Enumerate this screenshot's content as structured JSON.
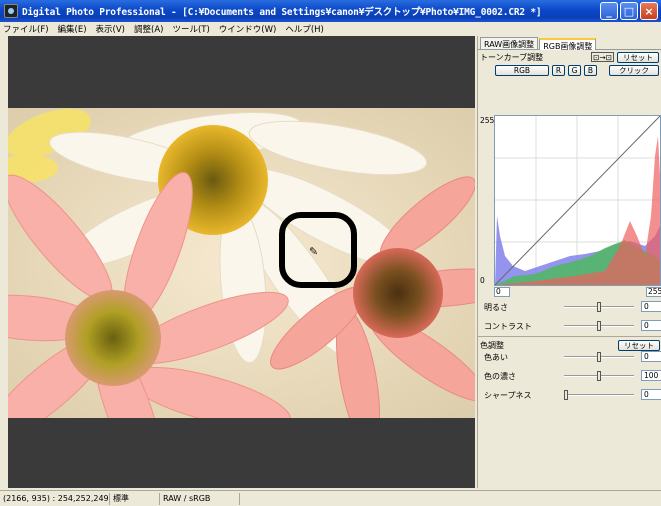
{
  "window": {
    "title": "Digital Photo Professional - [C:¥Documents and Settings¥canon¥デスクトップ¥Photo¥IMG_0002.CR2 *]",
    "minimize": "_",
    "maximize": "□",
    "close": "×"
  },
  "menu": [
    "ファイル(F)",
    "編集(E)",
    "表示(V)",
    "調整(A)",
    "ツール(T)",
    "ウインドウ(W)",
    "ヘルプ(H)"
  ],
  "panel": {
    "tabs": [
      {
        "label": "RAW画像調整",
        "active": false
      },
      {
        "label": "RGB画像調整",
        "active": true
      }
    ],
    "tone_curve": {
      "label": "トーンカーブ調整",
      "copy_icon": "⊡→⊡",
      "reset": "リセット",
      "rgb": "RGB",
      "r": "R",
      "g": "G",
      "b": "B",
      "click": "クリック",
      "max_left": "255",
      "min_left": "0",
      "input_min": "0",
      "input_max": "255"
    },
    "brightness": {
      "label": "明るさ",
      "value": "0",
      "level": 0.5
    },
    "contrast": {
      "label": "コントラスト",
      "value": "0",
      "level": 0.5
    },
    "color": {
      "section": "色調整",
      "reset": "リセット",
      "hue": {
        "label": "色あい",
        "value": "0",
        "level": 0.5
      },
      "saturation": {
        "label": "色の濃さ",
        "value": "100",
        "level": 0.5
      },
      "sharpness": {
        "label": "シャープネス",
        "value": "0",
        "level": 0.0
      }
    }
  },
  "status": {
    "coords": "(2166, 935) : 254,252,249",
    "mode": "標準",
    "format": "RAW / sRGB"
  }
}
